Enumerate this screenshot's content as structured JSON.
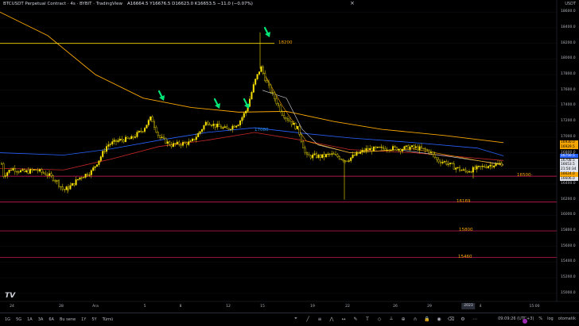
{
  "header": {
    "symbol": "BTCUSDT Perpetual Contract · 4s · BYBIT · TradingView",
    "ohlc": "A16664.5  Y16676.5  D16623.0  K16653.5  −11.0 (−0.07%)"
  },
  "currency": "USDT",
  "y_axis": [
    "18600.0",
    "18400.0",
    "18200.0",
    "18000.0",
    "17800.0",
    "17600.0",
    "17400.0",
    "17200.0",
    "17000.0",
    "16800.0",
    "16600.0",
    "16400.0",
    "16200.0",
    "16000.0",
    "15800.0",
    "15600.0",
    "15400.0",
    "15200.0",
    "15000.0"
  ],
  "x_axis": [
    "24",
    "28",
    "Ara",
    "5",
    "8",
    "12",
    "15",
    "19",
    "22",
    "26",
    "29",
    "4",
    "15:00"
  ],
  "x_highlight": "2023",
  "levels": [
    {
      "label": "18200",
      "price": 18200,
      "color": "#f7e000"
    },
    {
      "label": "17080",
      "price": 17080,
      "color": "#f7a600"
    },
    {
      "label": "16500",
      "price": 16500,
      "color": "#e91e63"
    },
    {
      "label": "16169",
      "price": 16169,
      "color": "#e91e63"
    },
    {
      "label": "15800",
      "price": 15800,
      "color": "#e91e63"
    },
    {
      "label": "15460",
      "price": 15460,
      "color": "#e91e63"
    }
  ],
  "price_tags": [
    {
      "text": "16930.0",
      "bg": "#f7a600",
      "price": 16930
    },
    {
      "text": "16929.5",
      "bg": "#f7a600",
      "price": 16900
    },
    {
      "text": "16750.5",
      "bg": "#2962ff",
      "price": 16760
    },
    {
      "text": "16708.5",
      "bg": "#e0e3eb",
      "price": 16725
    },
    {
      "text": "16653.5",
      "bg": "#e0e3eb",
      "price": 16665
    },
    {
      "text": "21:50:34",
      "bg": "#e0e3eb",
      "price": 16635
    },
    {
      "text": "16624.0",
      "bg": "#f7a600",
      "price": 16600
    },
    {
      "text": "16606.0",
      "bg": "#e0e3eb",
      "price": 16570
    }
  ],
  "bottom": {
    "timeframes": [
      "1G",
      "5G",
      "1A",
      "3A",
      "6A",
      "Bu sene",
      "1Y",
      "5Y",
      "Tümü"
    ],
    "clock": "09:09:26 (UTC+3)",
    "pct": "%",
    "log": "log",
    "auto": "otomatik"
  },
  "tv_logo": "TV",
  "colors": {
    "candle": "#f7e000",
    "ma_orange": "#f7a600",
    "ma_blue": "#2962ff",
    "ma_red": "#b71c1c",
    "ma_white": "#d1d4dc",
    "arrow": "#00e676"
  }
}
